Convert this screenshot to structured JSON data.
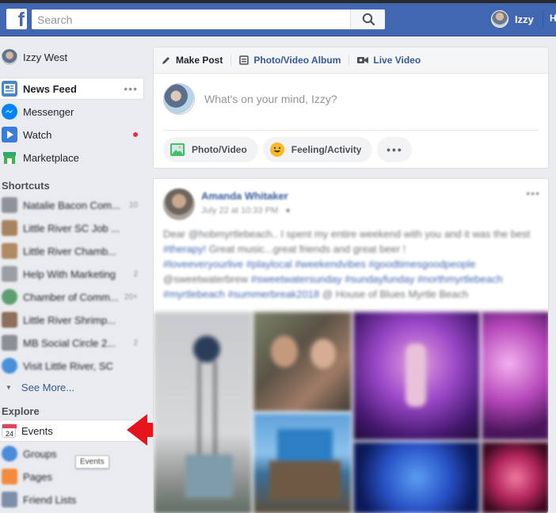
{
  "topbar": {
    "search_placeholder": "Search",
    "logo_letter": "f",
    "user_name": "Izzy",
    "home_initial": "H"
  },
  "sidebar": {
    "profile_name": "Izzy West",
    "main_items": [
      {
        "label": "News Feed",
        "icon": "news-feed-icon",
        "active": true
      },
      {
        "label": "Messenger",
        "icon": "messenger-icon"
      },
      {
        "label": "Watch",
        "icon": "watch-icon",
        "notification": true
      },
      {
        "label": "Marketplace",
        "icon": "marketplace-icon"
      }
    ],
    "more_dots": "•••",
    "shortcuts_header": "Shortcuts",
    "shortcuts": [
      {
        "label": "Natalie Bacon Com...",
        "count": "10"
      },
      {
        "label": "Little River SC Job ...",
        "count": ""
      },
      {
        "label": "Little River Chamb...",
        "count": ""
      },
      {
        "label": "Help With Marketing",
        "count": "2"
      },
      {
        "label": "Chamber of Comm...",
        "count": "20+"
      },
      {
        "label": "Little River Shrimp...",
        "count": ""
      },
      {
        "label": "MB Social Circle 2...",
        "count": "2"
      },
      {
        "label": "Visit Little River, SC",
        "count": ""
      }
    ],
    "see_more": "See More...",
    "explore_header": "Explore",
    "explore": [
      {
        "label": "Events",
        "icon": "events-calendar-icon",
        "highlighted": true,
        "badge": "24"
      },
      {
        "label": "Groups",
        "icon": "groups-icon"
      },
      {
        "label": "Pages",
        "icon": "pages-flag-icon"
      },
      {
        "label": "Friend Lists",
        "icon": "friend-lists-icon"
      }
    ],
    "tooltip": "Events"
  },
  "composer": {
    "tabs": [
      "Make Post",
      "Photo/Video Album",
      "Live Video"
    ],
    "placeholder": "What's on your mind, Izzy?",
    "actions": [
      "Photo/Video",
      "Feeling/Activity"
    ],
    "more": "•••"
  },
  "post": {
    "author": "Amanda Whitaker",
    "time": "July 22 at 10:33 PM",
    "text_plain": "Dear @hobmyrtlebeach.. I spent my entire weekend with you and it was the best ",
    "tag_1": "#therapy!",
    "text_2": " Great music...great friends and great beer !",
    "hashtags_line": "#loveeveryourlive #playlocal #weekendvibes #goodtimesgoodpeople",
    "line_4_plain": "@sweetwaterbrew ",
    "line_4_tags": "#sweetwatersunday #sundayfunday #northmyrtlebeach",
    "line_5_tags": "#myrtlebeach #summerbreak2018",
    "line_5_plain": " @ House of Blues Myrtle Beach",
    "more": "•••"
  },
  "colors": {
    "brand_blue": "#4267b2",
    "link_blue": "#365899",
    "arrow_red": "#e8141b",
    "notification_red": "#f02849"
  }
}
